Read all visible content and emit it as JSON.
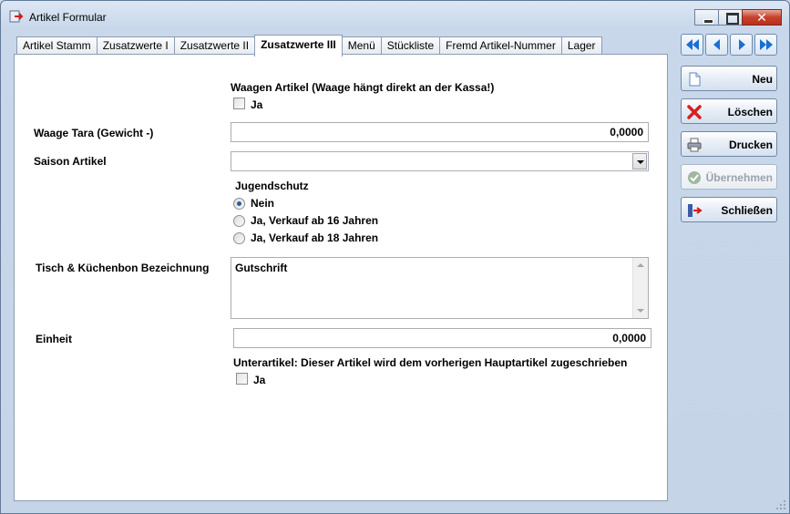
{
  "window": {
    "title": "Artikel Formular"
  },
  "tabs": [
    {
      "label": "Artikel Stamm"
    },
    {
      "label": "Zusatzwerte I"
    },
    {
      "label": "Zusatzwerte II"
    },
    {
      "label": "Zusatzwerte III",
      "active": true
    },
    {
      "label": "Menü"
    },
    {
      "label": "Stückliste"
    },
    {
      "label": "Fremd Artikel-Nummer"
    },
    {
      "label": "Lager"
    }
  ],
  "form": {
    "waagen_heading": "Waagen Artikel (Waage hängt direkt an der Kassa!)",
    "waagen_checkbox_label": "Ja",
    "waagen_checked": false,
    "tara_label": "Waage Tara (Gewicht -)",
    "tara_value": "0,0000",
    "saison_label": "Saison Artikel",
    "saison_value": "",
    "jugendschutz_heading": "Jugendschutz",
    "jugendschutz_options": [
      {
        "label": "Nein",
        "selected": true
      },
      {
        "label": "Ja, Verkauf ab 16 Jahren",
        "selected": false
      },
      {
        "label": "Ja, Verkauf ab 18 Jahren",
        "selected": false
      }
    ],
    "bon_label": "Tisch & Küchenbon Bezeichnung",
    "bon_value": "Gutschrift",
    "einheit_label": "Einheit",
    "einheit_value": "0,0000",
    "unterartikel_heading": "Unterartikel: Dieser Artikel wird dem vorherigen Hauptartikel zugeschrieben",
    "unterartikel_checkbox_label": "Ja",
    "unterartikel_checked": false
  },
  "actions": {
    "neu": "Neu",
    "loeschen": "Löschen",
    "drucken": "Drucken",
    "uebernehmen": "Übernehmen",
    "schliessen": "Schließen"
  },
  "icons": {
    "first": "first-record-icon",
    "prev": "previous-record-icon",
    "next": "next-record-icon",
    "last": "last-record-icon"
  },
  "colors": {
    "window_frame": "#c8d7ea",
    "nav_arrow": "#1a6fd6",
    "delete_x": "#d42121",
    "close_button": "#c7412b"
  }
}
